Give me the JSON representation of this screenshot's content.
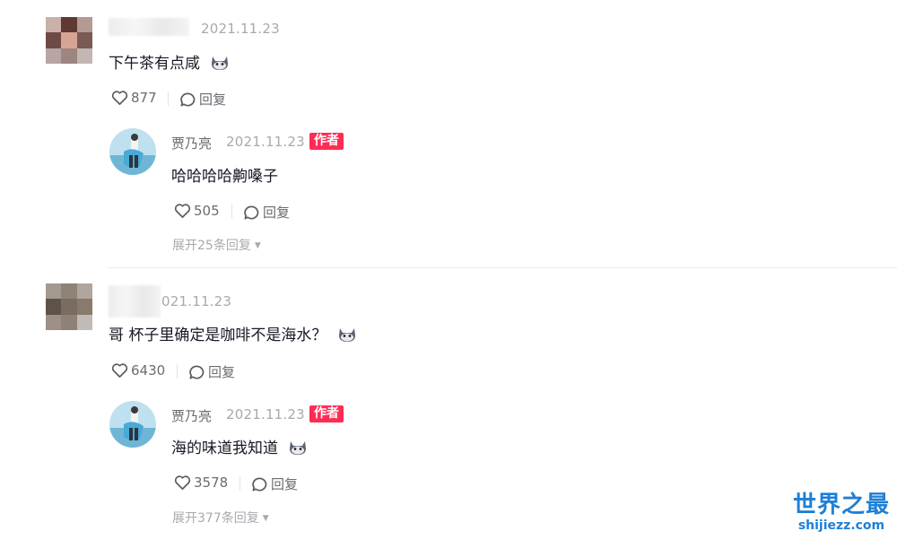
{
  "comments": [
    {
      "date": "2021.11.23",
      "text": "下午茶有点咸",
      "likes": "877",
      "reply_label": "回复",
      "reply": {
        "author": "贾乃亮",
        "date": "2021.11.23",
        "badge": "作者",
        "text": "哈哈哈哈齁嗓子",
        "likes": "505",
        "reply_label": "回复",
        "expand": "展开25条回复"
      }
    },
    {
      "date": "021.11.23",
      "text": "哥 杯子里确定是咖啡不是海水？",
      "likes": "6430",
      "reply_label": "回复",
      "reply": {
        "author": "贾乃亮",
        "date": "2021.11.23",
        "badge": "作者",
        "text": "海的味道我知道",
        "likes": "3578",
        "reply_label": "回复",
        "expand": "展开377条回复"
      }
    }
  ],
  "watermark": {
    "title": "世界之最",
    "url": "shijiezz.com"
  },
  "colors": {
    "author_badge": "#fe2c55",
    "muted": "#a8a9ad",
    "text": "#161823",
    "watermark": "#1e7fd6"
  },
  "icons": [
    "heart-icon",
    "comment-bubble-icon",
    "cat-emoji-icon",
    "chevron-down-icon"
  ]
}
